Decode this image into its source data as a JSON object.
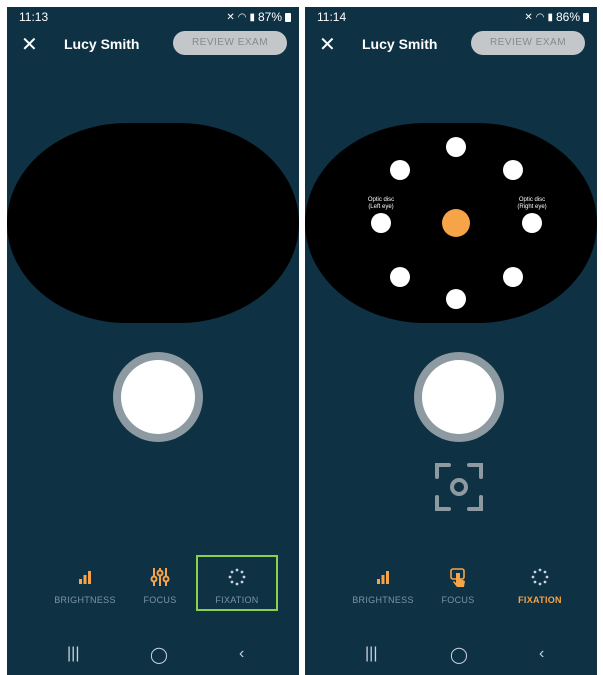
{
  "left": {
    "status": {
      "time": "11:13",
      "battery": "87%"
    },
    "header": {
      "patient": "Lucy Smith",
      "review": "REVIEW EXAM"
    },
    "tabs": [
      {
        "label": "BRIGHTNESS"
      },
      {
        "label": "FOCUS"
      },
      {
        "label": "FIXATION"
      }
    ],
    "highlighted_tab": "FIXATION"
  },
  "right": {
    "status": {
      "time": "11:14",
      "battery": "86%"
    },
    "header": {
      "patient": "Lucy Smith",
      "review": "REVIEW EXAM"
    },
    "labels": {
      "left_disc": "Optic disc\n(Left eye)",
      "right_disc": "Optic disc\n(Right eye)"
    },
    "tabs": [
      {
        "label": "BRIGHTNESS"
      },
      {
        "label": "FOCUS"
      },
      {
        "label": "FIXATION"
      }
    ],
    "active_tab": "FIXATION"
  },
  "colors": {
    "background": "#0e3144",
    "accent": "#f6a447",
    "highlight": "#8bd04a"
  },
  "icons": [
    "close-icon",
    "mute-icon",
    "wifi-icon",
    "signal-icon",
    "battery-icon",
    "brightness-icon",
    "focus-sliders-icon",
    "touch-icon",
    "fixation-icon",
    "focus-target-icon",
    "recents-icon",
    "home-icon",
    "back-icon"
  ]
}
